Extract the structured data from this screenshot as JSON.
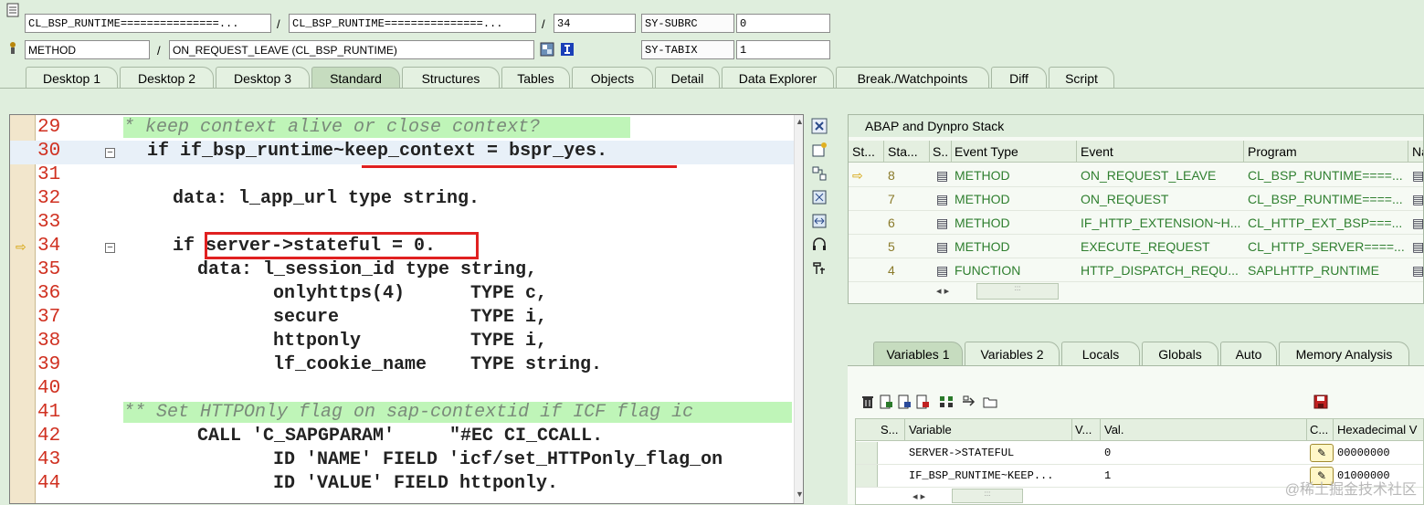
{
  "header": {
    "row1": {
      "field1": "CL_BSP_RUNTIME===============...",
      "field2": "CL_BSP_RUNTIME===============...",
      "field3": "34",
      "label": "SY-SUBRC",
      "value": "0"
    },
    "row2": {
      "field1": "METHOD",
      "field2": "ON_REQUEST_LEAVE (CL_BSP_RUNTIME)",
      "label": "SY-TABIX",
      "value": "1"
    },
    "slash": "/"
  },
  "tabs": [
    "Desktop 1",
    "Desktop 2",
    "Desktop 3",
    "Standard",
    "Structures",
    "Tables",
    "Objects",
    "Detail",
    "Data Explorer",
    "Break./Watchpoints",
    "Diff",
    "Script"
  ],
  "active_tab": "Standard",
  "editor": {
    "lines": [
      {
        "n": "29",
        "text": "* keep context alive or close context?"
      },
      {
        "n": "30",
        "text": "if if_bsp_runtime~keep_context = bspr_yes."
      },
      {
        "n": "31",
        "text": ""
      },
      {
        "n": "32",
        "text": "data: l_app_url type string."
      },
      {
        "n": "33",
        "text": ""
      },
      {
        "n": "34",
        "text": "if server->stateful = 0."
      },
      {
        "n": "35",
        "text": "data: l_session_id type string,"
      },
      {
        "n": "36",
        "text": "onlyhttps(4)      TYPE c,"
      },
      {
        "n": "37",
        "text": "secure            TYPE i,"
      },
      {
        "n": "38",
        "text": "httponly          TYPE i,"
      },
      {
        "n": "39",
        "text": "lf_cookie_name    TYPE string."
      },
      {
        "n": "40",
        "text": ""
      },
      {
        "n": "41",
        "text": "** Set HTTPOnly flag on sap-contextid if ICF flag ic"
      },
      {
        "n": "42",
        "text": "CALL 'C_SAPGPARAM'     \"#EC CI_CCALL."
      },
      {
        "n": "43",
        "text": "ID 'NAME' FIELD 'icf/set_HTTPonly_flag_on"
      },
      {
        "n": "44",
        "text": "ID 'VALUE' FIELD httponly."
      }
    ]
  },
  "stack": {
    "title": "ABAP and Dynpro Stack",
    "columns": [
      "St...",
      "Sta...",
      "S..",
      "Event Type",
      "Event",
      "Program",
      "Na"
    ],
    "rows": [
      {
        "level": "8",
        "type": "METHOD",
        "event": "ON_REQUEST_LEAVE",
        "program": "CL_BSP_RUNTIME====..."
      },
      {
        "level": "7",
        "type": "METHOD",
        "event": "ON_REQUEST",
        "program": "CL_BSP_RUNTIME====..."
      },
      {
        "level": "6",
        "type": "METHOD",
        "event": "IF_HTTP_EXTENSION~H...",
        "program": "CL_HTTP_EXT_BSP===..."
      },
      {
        "level": "5",
        "type": "METHOD",
        "event": "EXECUTE_REQUEST",
        "program": "CL_HTTP_SERVER====..."
      },
      {
        "level": "4",
        "type": "FUNCTION",
        "event": "HTTP_DISPATCH_REQU...",
        "program": "SAPLHTTP_RUNTIME"
      }
    ],
    "scroll_dots": ":::"
  },
  "var_tabs": [
    "Variables 1",
    "Variables 2",
    "Locals",
    "Globals",
    "Auto",
    "Memory Analysis"
  ],
  "variables": {
    "columns": [
      "S...",
      "Variable",
      "V...",
      "Val.",
      "C...",
      "Hexadecimal V"
    ],
    "rows": [
      {
        "name": "SERVER->STATEFUL",
        "value": "0",
        "hex": "00000000"
      },
      {
        "name": "IF_BSP_RUNTIME~KEEP...",
        "value": "1",
        "hex": "01000000"
      }
    ],
    "scroll_dots": ":::"
  },
  "watermark": "@稀土掘金技术社区",
  "colors": {
    "accent_red": "#e02020",
    "line_number": "#d03020",
    "comment_bg": "#bff5b8"
  }
}
